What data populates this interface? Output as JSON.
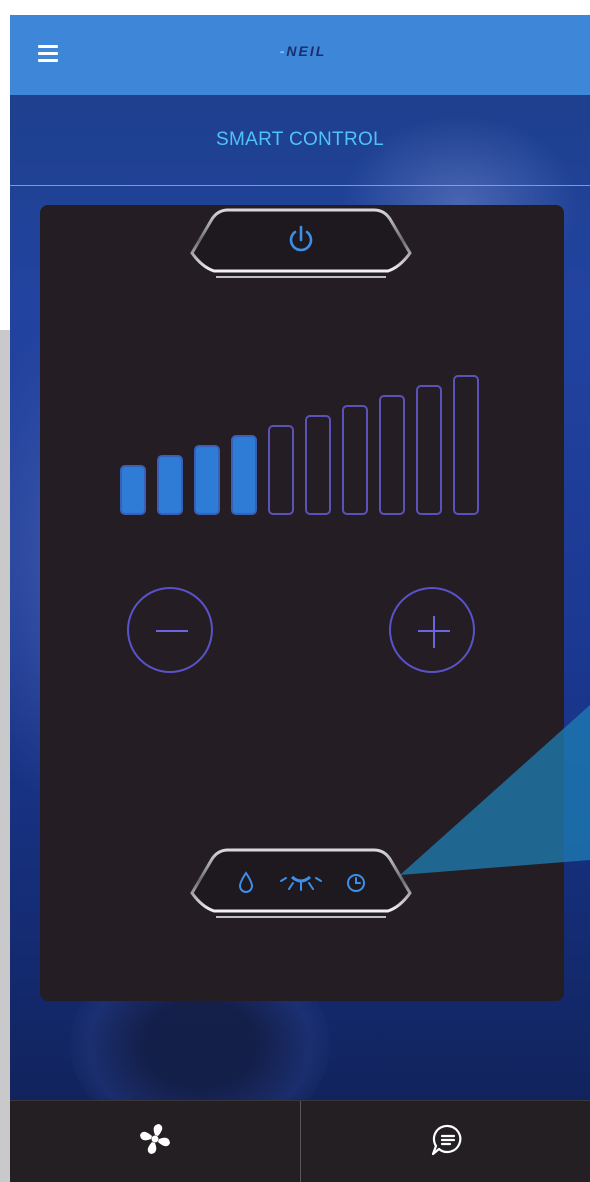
{
  "header": {
    "logo_dash": "-",
    "logo_text": "NEIL",
    "menu_icon": "hamburger-menu-icon"
  },
  "page": {
    "title": "SMART CONTROL"
  },
  "control": {
    "power_icon": "power-icon",
    "level": {
      "active": 4,
      "total": 10
    },
    "decrease_icon": "minus-icon",
    "increase_icon": "plus-icon",
    "modes": [
      "water-drop-icon",
      "light-icon",
      "timer-icon"
    ]
  },
  "bottom_nav": {
    "items": [
      "fan-icon",
      "chat-icon"
    ]
  },
  "colors": {
    "header": "#3d86d8",
    "title": "#4fc3f7",
    "panel": "#241e24",
    "bar_on": "#2e7cd6",
    "bar_off_border": "#5a52b8",
    "button_ring": "#5a52c8",
    "bottom_bar": "#231f22"
  }
}
